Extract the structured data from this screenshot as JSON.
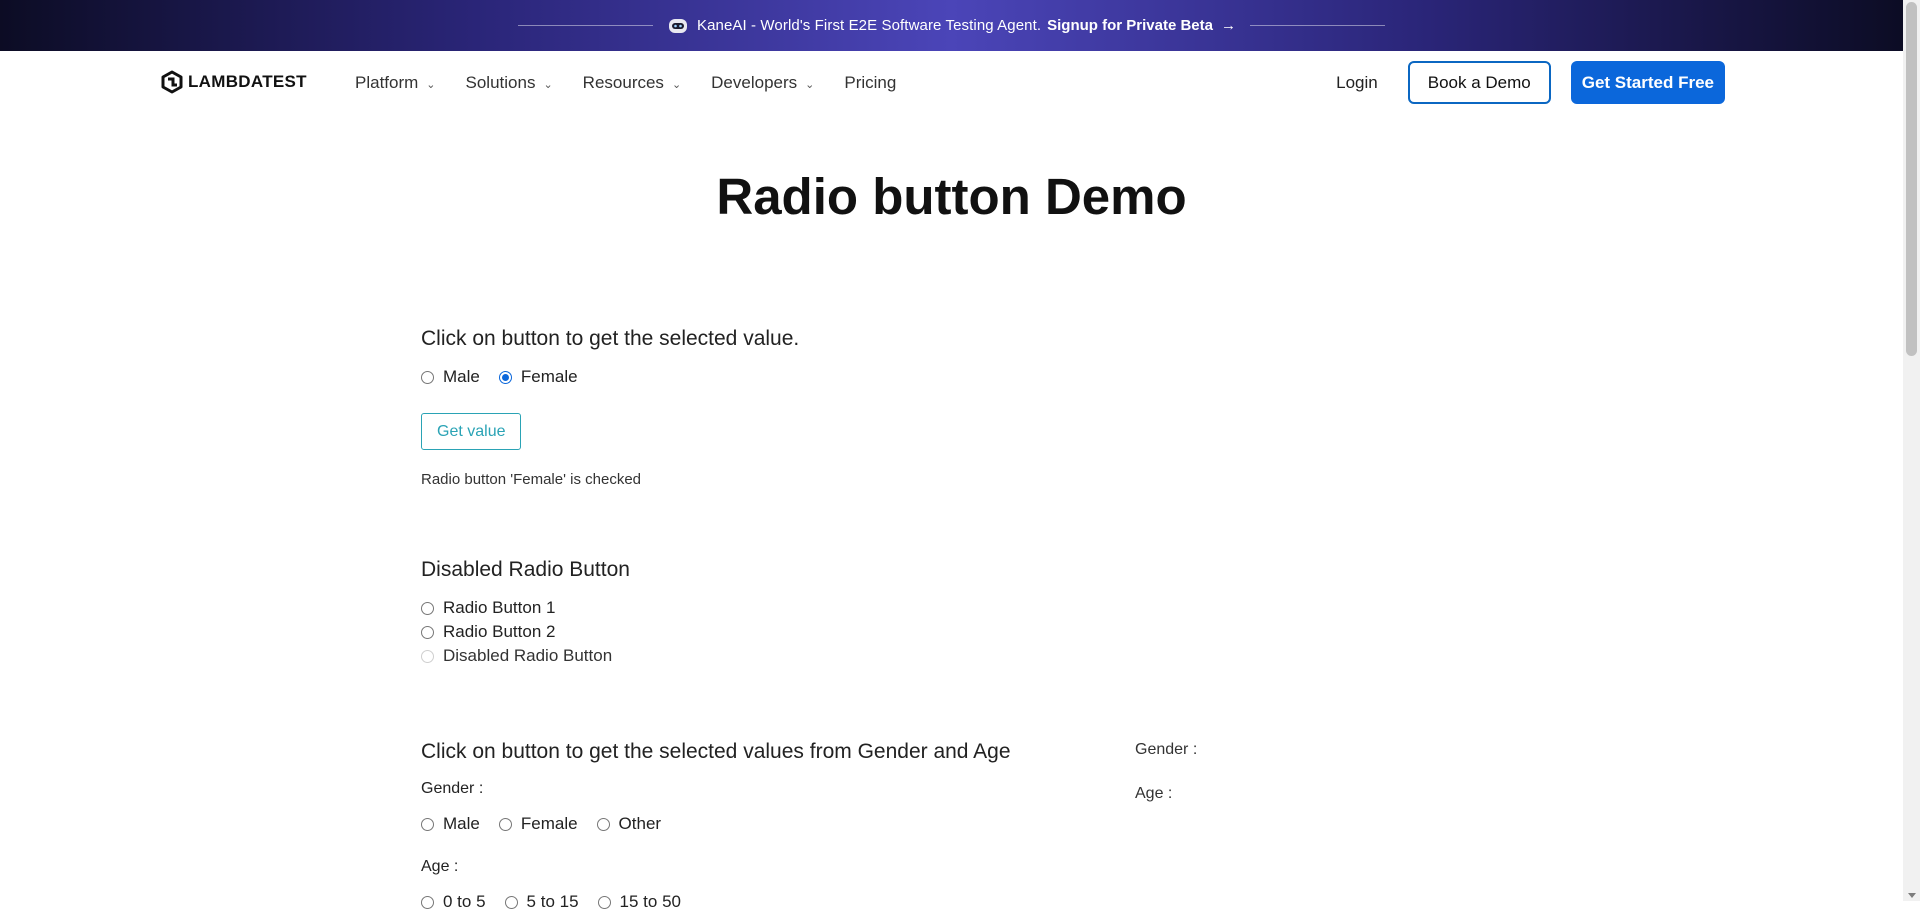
{
  "banner": {
    "message": "KaneAI - World's First E2E Software Testing Agent.",
    "cta": "Signup for Private Beta",
    "arrow": "→"
  },
  "nav": {
    "logo_text": "LAMBDATEST",
    "menu": [
      {
        "label": "Platform",
        "has_dropdown": true
      },
      {
        "label": "Solutions",
        "has_dropdown": true
      },
      {
        "label": "Resources",
        "has_dropdown": true
      },
      {
        "label": "Developers",
        "has_dropdown": true
      },
      {
        "label": "Pricing",
        "has_dropdown": false
      }
    ],
    "login": "Login",
    "book_demo": "Book a Demo",
    "get_started": "Get Started Free"
  },
  "page_title": "Radio button Demo",
  "section1": {
    "heading": "Click on button to get the selected value.",
    "options": [
      "Male",
      "Female"
    ],
    "selected": "Female",
    "button": "Get value",
    "result": "Radio button 'Female' is checked"
  },
  "section2": {
    "heading": "Disabled Radio Button",
    "options": [
      "Radio Button 1",
      "Radio Button 2",
      "Disabled Radio Button"
    ]
  },
  "section3": {
    "heading": "Click on button to get the selected values from Gender and Age",
    "gender_label": "Gender :",
    "gender_options": [
      "Male",
      "Female",
      "Other"
    ],
    "age_label": "Age :",
    "age_options": [
      "0 to 5",
      "5 to 15",
      "15 to 50"
    ],
    "result_gender_label": "Gender :",
    "result_age_label": "Age :"
  },
  "colors": {
    "primary": "#0b67db",
    "teal_button": "#2aa3b5",
    "banner_mid": "#4b45b8"
  }
}
